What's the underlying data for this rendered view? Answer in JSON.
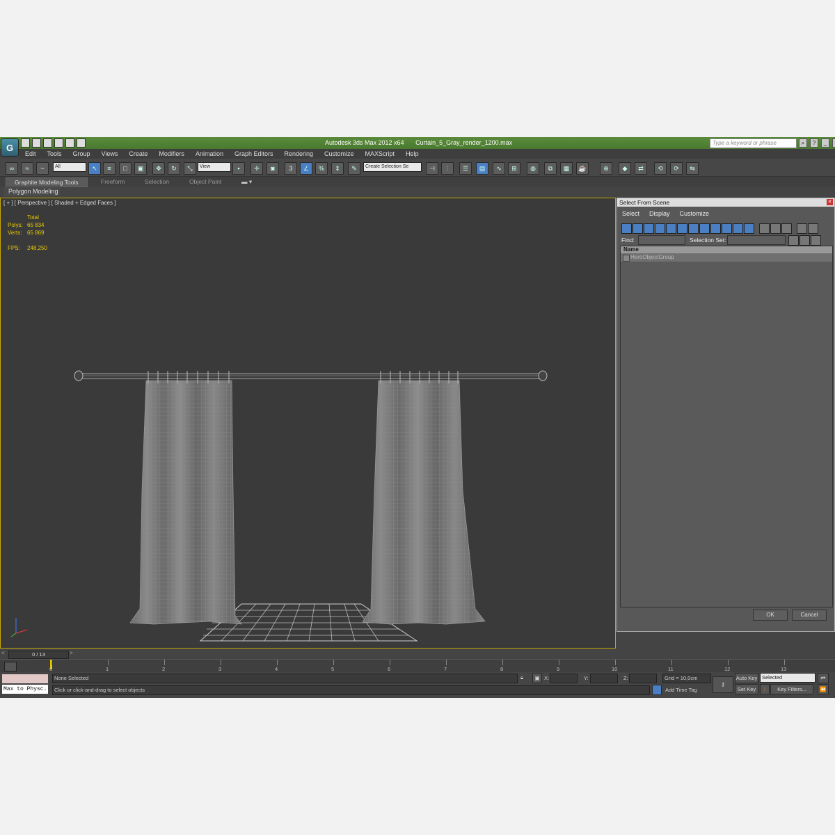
{
  "window": {
    "app_title": "Autodesk 3ds Max  2012 x64",
    "file_name": "Curtain_5_Gray_render_1200.max",
    "search_placeholder": "Type a keyword or phrase"
  },
  "menu": [
    "Edit",
    "Tools",
    "Group",
    "Views",
    "Create",
    "Modifiers",
    "Animation",
    "Graph Editors",
    "Rendering",
    "Customize",
    "MAXScript",
    "Help"
  ],
  "toolbar": {
    "filter_value": "All",
    "coord_value": "View",
    "selection_set_placeholder": "Create Selection Se"
  },
  "ribbon": {
    "tabs": [
      "Graphite Modeling Tools",
      "Freeform",
      "Selection",
      "Object Paint"
    ],
    "panel": "Polygon Modeling"
  },
  "viewport": {
    "label": "[ + ] [ Perspective ] [ Shaded + Edged Faces ]",
    "stats": {
      "header": "Total",
      "polys_label": "Polys:",
      "polys": "65 834",
      "verts_label": "Verts:",
      "verts": "65 869",
      "fps_label": "FPS:",
      "fps": "248,250"
    }
  },
  "dialog": {
    "title": "Select From Scene",
    "menu": [
      "Select",
      "Display",
      "Customize"
    ],
    "find_label": "Find:",
    "selection_set_label": "Selection Set:",
    "column_name": "Name",
    "items": [
      "HeroObjectGroup"
    ],
    "ok": "OK",
    "cancel": "Cancel"
  },
  "timeline": {
    "frame_counter": "0 / 13",
    "ticks": [
      "0",
      "1",
      "2",
      "3",
      "4",
      "5",
      "6",
      "7",
      "8",
      "9",
      "10",
      "11",
      "12",
      "13"
    ]
  },
  "status": {
    "maxscript": "Max to Physc.",
    "selection": "None Selected",
    "prompt": "Click or click-and-drag to select objects",
    "x_label": "X:",
    "y_label": "Y:",
    "z_label": "Z:",
    "grid": "Grid = 10,0cm",
    "add_time_tag": "Add Time Tag",
    "auto_key": "Auto Key",
    "set_key": "Set Key",
    "key_mode": "Selected",
    "key_filters": "Key Filters..."
  }
}
